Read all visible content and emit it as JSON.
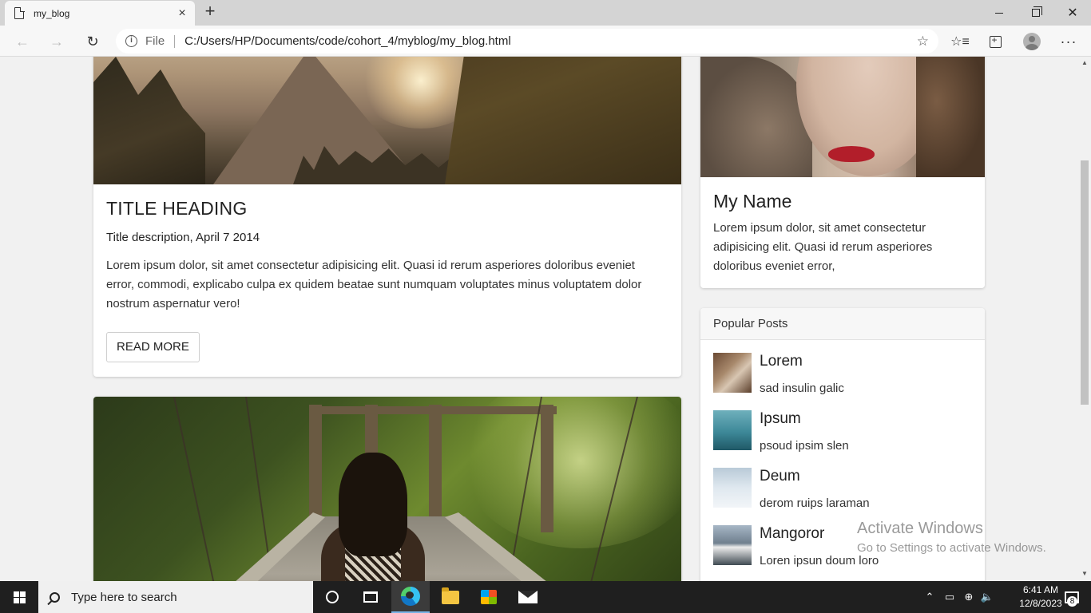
{
  "browser": {
    "tab_title": "my_blog",
    "new_tab": "+",
    "close_tab": "×",
    "address_scheme": "File",
    "address_url": "C:/Users/HP/Documents/code/cohort_4/myblog/my_blog.html"
  },
  "icons": {
    "back": "arrow-left-icon",
    "forward": "arrow-right-icon",
    "refresh": "refresh-icon",
    "favorite": "star-icon",
    "favorites": "favorites-icon",
    "collections": "collections-icon",
    "profile": "profile-icon",
    "more": "more-icon"
  },
  "posts": [
    {
      "title": "TITLE HEADING",
      "subtitle": "Title description, April 7 2014",
      "body": "Lorem ipsum dolor, sit amet consectetur adipisicing elit. Quasi id rerum asperiores doloribus eveniet error, commodi, explicabo culpa ex quidem beatae sunt numquam voluptates minus voluptatem dolor nostrum aspernatur vero!",
      "button": "READ MORE"
    }
  ],
  "profile": {
    "name": "My Name",
    "bio": "Lorem ipsum dolor, sit amet consectetur adipisicing elit. Quasi id rerum asperiores doloribus eveniet error,"
  },
  "popular": {
    "header": "Popular Posts",
    "items": [
      {
        "title": "Lorem",
        "subtitle": "sad insulin galic"
      },
      {
        "title": "Ipsum",
        "subtitle": "psoud ipsim slen"
      },
      {
        "title": "Deum",
        "subtitle": "derom ruips laraman"
      },
      {
        "title": "Mangoror",
        "subtitle": "Loren ipsun doum loro"
      }
    ]
  },
  "watermark": {
    "line1": "Activate Windows",
    "line2": "Go to Settings to activate Windows."
  },
  "taskbar": {
    "search_placeholder": "Type here to search",
    "time": "6:41 AM",
    "date": "12/8/2023",
    "notification_count": "8"
  }
}
